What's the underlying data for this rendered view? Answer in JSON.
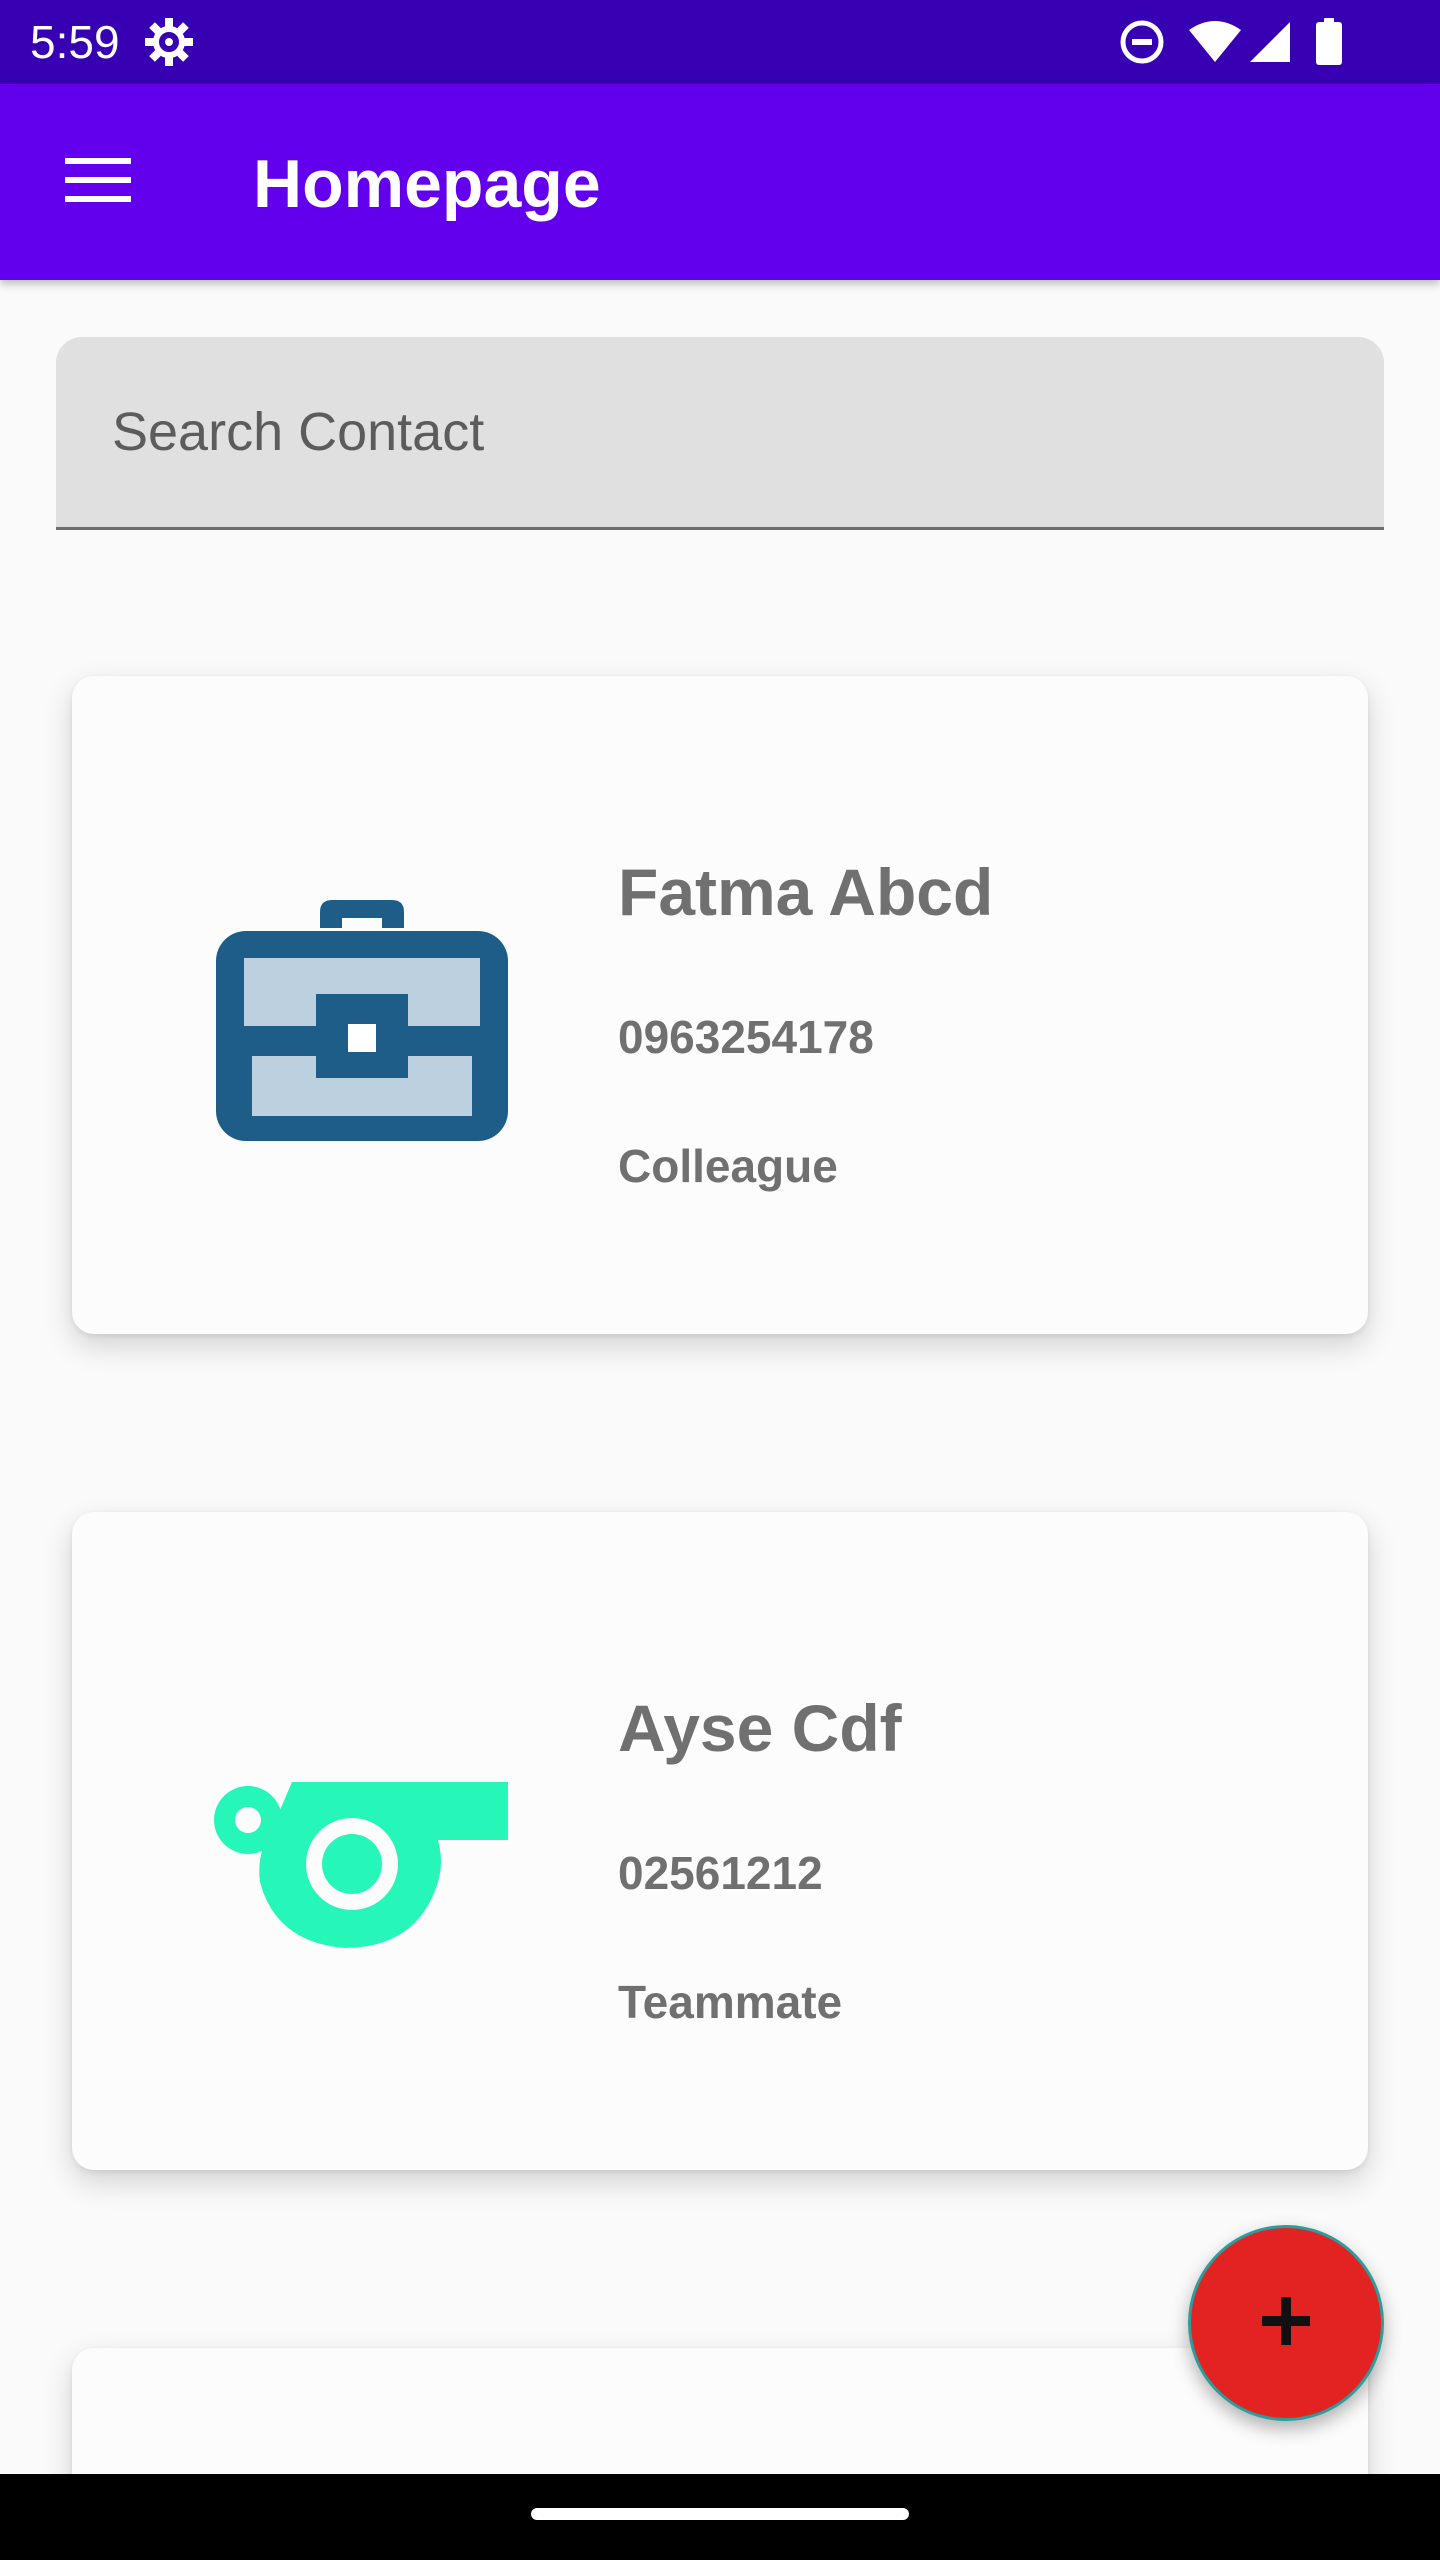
{
  "status_bar": {
    "time": "5:59",
    "icons": [
      "settings-gear-icon",
      "do-not-disturb-icon",
      "wifi-icon",
      "cellular-signal-icon",
      "battery-icon"
    ]
  },
  "app_bar": {
    "title": "Homepage",
    "menu_icon": "hamburger-menu-icon",
    "background_color": "#6200ee"
  },
  "search": {
    "placeholder": "Search Contact",
    "value": ""
  },
  "contacts": [
    {
      "name": "Fatma Abcd",
      "phone": "0963254178",
      "group": "Colleague",
      "icon": "briefcase-icon",
      "icon_color": "#1d5d87"
    },
    {
      "name": "Ayse Cdf",
      "phone": "02561212",
      "group": "Teammate",
      "icon": "whistle-icon",
      "icon_color": "#26f7b9"
    }
  ],
  "fab": {
    "icon": "plus-icon",
    "color": "#e32322"
  },
  "colors": {
    "status_bar": "#3700b3",
    "text_secondary": "#707070",
    "background": "#fafafa"
  }
}
